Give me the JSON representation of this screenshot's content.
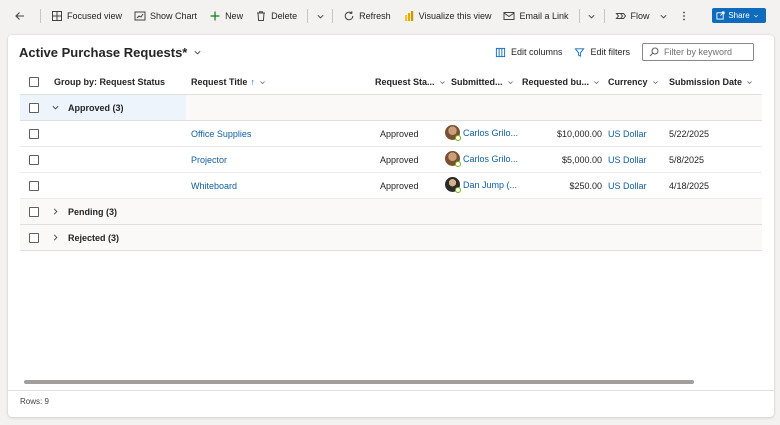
{
  "toolbar": {
    "back_icon": "back-arrow-icon",
    "focused_view": "Focused view",
    "show_chart": "Show Chart",
    "new": "New",
    "delete": "Delete",
    "refresh": "Refresh",
    "visualize": "Visualize this view",
    "email_link": "Email a Link",
    "flow": "Flow",
    "share": "Share"
  },
  "view": {
    "title": "Active Purchase Requests*",
    "edit_columns": "Edit columns",
    "edit_filters": "Edit filters",
    "filter_placeholder": "Filter by keyword"
  },
  "grid": {
    "columns": {
      "group_by": "Group by: Request Status",
      "request_title": "Request Title",
      "request_title_sort": "↑",
      "request_status": "Request Sta...",
      "submitted_by": "Submitted...",
      "requested_budget": "Requested bu...",
      "currency": "Currency",
      "submission_date": "Submission Date"
    },
    "groups": [
      {
        "label": "Approved (3)",
        "expanded": true
      },
      {
        "label": "Pending (3)",
        "expanded": false
      },
      {
        "label": "Rejected (3)",
        "expanded": false
      }
    ],
    "rows": [
      {
        "title": "Office Supplies",
        "status": "Approved",
        "submitted_by": "Carlos Grilo...",
        "budget": "$10,000.00",
        "currency": "US Dollar",
        "date": "5/22/2025"
      },
      {
        "title": "Projector",
        "status": "Approved",
        "submitted_by": "Carlos Grilo...",
        "budget": "$5,000.00",
        "currency": "US Dollar",
        "date": "5/8/2025"
      },
      {
        "title": "Whiteboard",
        "status": "Approved",
        "submitted_by": "Dan Jump (...",
        "budget": "$250.00",
        "currency": "US Dollar",
        "date": "4/18/2025"
      }
    ]
  },
  "footer": {
    "rows": "Rows: 9"
  },
  "colors": {
    "accent": "#0f6cbd",
    "link": "#115ea3",
    "presence": "#6bb700"
  }
}
